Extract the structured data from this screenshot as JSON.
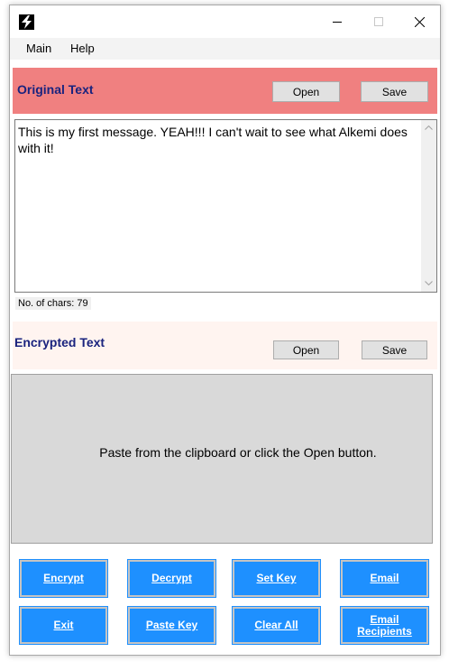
{
  "menu": {
    "main": "Main",
    "help": "Help"
  },
  "original": {
    "title": "Original Text",
    "open_label": "Open",
    "save_label": "Save",
    "text": "This is my first message. YEAH!!! I can't wait to see what Alkemi does with it!",
    "char_count": "No. of chars: 79"
  },
  "encrypted": {
    "title": "Encrypted Text",
    "open_label": "Open",
    "save_label": "Save",
    "placeholder": "Paste from the clipboard or click the Open button."
  },
  "actions": {
    "encrypt": "Encrypt",
    "decrypt": "Decrypt",
    "set_key": "Set Key",
    "email": "Email",
    "exit": "Exit",
    "paste_key": "Paste Key",
    "clear_all": "Clear All",
    "email_recipients": "Email Recipients"
  },
  "colors": {
    "original_panel": "#f08080",
    "encrypted_panel": "#fff4f0",
    "action_button": "#1e90ff",
    "title_text": "#1a237e"
  },
  "icons": {
    "app": "lightning-bolt-icon",
    "minimize": "minimize-icon",
    "maximize": "maximize-icon",
    "close": "close-icon",
    "scroll_up": "chevron-up-icon",
    "scroll_down": "chevron-down-icon"
  }
}
